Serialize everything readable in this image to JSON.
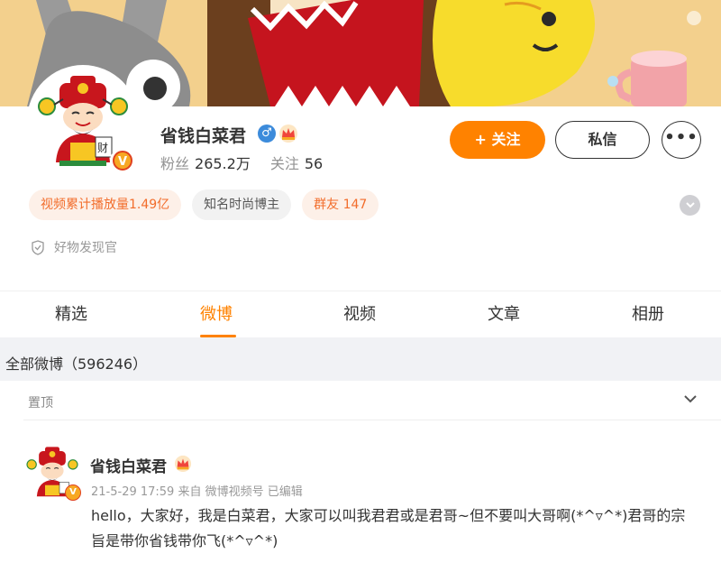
{
  "profile": {
    "name": "省钱白菜君",
    "gender_icon": "♂",
    "verified_icon": "V",
    "fans_label": "粉丝",
    "fans_count": "265.2万",
    "following_label": "关注",
    "following_count": "56",
    "follow_button": "+ 关注",
    "message_button": "私信",
    "more_button": "•••",
    "tags": [
      {
        "label": "视频累计播放量1.49亿",
        "style": "orange"
      },
      {
        "label": "知名时尚博主",
        "style": "gray"
      },
      {
        "label": "群友 147",
        "style": "orange"
      }
    ],
    "shop_label": "好物发现官"
  },
  "tabs": [
    {
      "label": "精选",
      "active": false
    },
    {
      "label": "微博",
      "active": true
    },
    {
      "label": "视频",
      "active": false
    },
    {
      "label": "文章",
      "active": false
    },
    {
      "label": "相册",
      "active": false
    }
  ],
  "feed": {
    "heading": "全部微博（596246）",
    "pinned_label": "置顶",
    "post": {
      "author": "省钱白菜君",
      "meta": "21-5-29 17:59  来自 微博视频号 已编辑",
      "text": "hello，大家好，我是白菜君，大家可以叫我君君或是君哥~但不要叫大哥啊(*^▿^*)君哥的宗旨是带你省钱带你飞(*^▿^*)"
    }
  },
  "colors": {
    "accent": "#ff8200",
    "tag_orange_text": "#f26d2b",
    "tag_orange_bg": "#fdf0e8",
    "gender_blue": "#3c8bdb"
  },
  "icons": [
    "gender-male-icon",
    "crown-icon",
    "verified-v-icon",
    "chevron-down-icon",
    "shield-icon",
    "more-dots-icon"
  ]
}
